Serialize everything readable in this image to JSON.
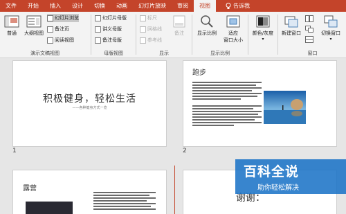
{
  "tabs": [
    "文件",
    "开始",
    "插入",
    "设计",
    "切换",
    "动画",
    "幻灯片放映",
    "审阅",
    "视图"
  ],
  "active_tab": "视图",
  "tell_me": "告诉我",
  "ribbon": {
    "normal": "普通",
    "outline_view": "大纲视图",
    "slide_sorter": "幻灯片浏览",
    "notes_page": "备注页",
    "reading_view": "阅读视图",
    "group_presentation_views": "演示文稿视图",
    "slide_master": "幻灯片母版",
    "handout_master": "讲义母版",
    "notes_master": "备注母版",
    "group_master_views": "母版视图",
    "ruler": "标尺",
    "gridlines": "网格线",
    "guides": "参考线",
    "notes": "备注",
    "group_show": "显示",
    "zoom": "显示比例",
    "fit_window": "适应\n窗口大小",
    "group_zoom": "显示比例",
    "color_grayscale": "颜色/灰度",
    "new_window": "新建窗口",
    "switch_windows": "切换窗口",
    "group_window": "窗口"
  },
  "slides": [
    {
      "number": "1",
      "title": "积极健身，轻松生活",
      "subtitle": "——各种健身方式一览"
    },
    {
      "number": "2",
      "title": "跑步"
    },
    {
      "title": "露营"
    },
    {
      "title": "谢谢："
    }
  ],
  "watermark": {
    "line1": "百科全说",
    "line2": "助你轻松解决"
  },
  "colors": {
    "accent": "#c4442a",
    "watermark": "#1d74c7"
  }
}
